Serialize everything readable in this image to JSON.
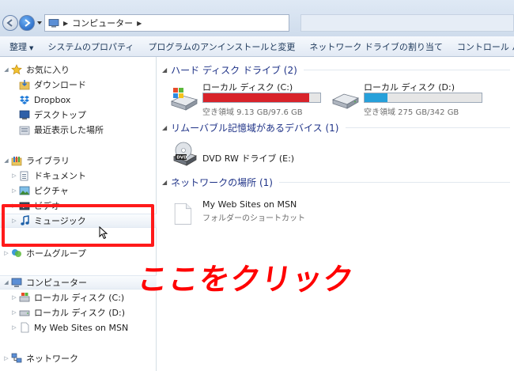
{
  "address": {
    "breadcrumb": "コンピューター"
  },
  "toolbar": {
    "organize": "整理",
    "system_properties": "システムのプロパティ",
    "uninstall": "プログラムのアンインストールと変更",
    "map_drive": "ネットワーク ドライブの割り当て",
    "control_panel": "コントロール パネルを開"
  },
  "nav": {
    "favorites": "お気に入り",
    "downloads": "ダウンロード",
    "dropbox": "Dropbox",
    "desktop": "デスクトップ",
    "recent": "最近表示した場所",
    "libraries": "ライブラリ",
    "documents": "ドキュメント",
    "pictures": "ピクチャ",
    "videos": "ビデオ",
    "music": "ミュージック",
    "homegroup": "ホームグループ",
    "computer": "コンピューター",
    "local_c": "ローカル ディスク (C:)",
    "local_d": "ローカル ディスク (D:)",
    "web_sites": "My Web Sites on MSN",
    "network": "ネットワーク"
  },
  "content": {
    "hdd_group": "ハード ディスク ドライブ (2)",
    "removable_group": "リムーバブル記憶域があるデバイス (1)",
    "network_group": "ネットワークの場所 (1)",
    "drive_c": {
      "name": "ローカル ディスク (C:)",
      "space": "空き領域 9.13 GB/97.6 GB",
      "used_fraction": 0.906,
      "bar_color": "#d8232a"
    },
    "drive_d": {
      "name": "ローカル ディスク (D:)",
      "space": "空き領域 275 GB/342 GB",
      "used_fraction": 0.196,
      "bar_color": "#26a0da"
    },
    "dvd": {
      "name": "DVD RW ドライブ (E:)"
    },
    "web_sites": {
      "name": "My Web Sites on MSN",
      "type": "フォルダーのショートカット"
    }
  },
  "annotation": {
    "label": "ここをクリック",
    "color": "#ff0000"
  }
}
